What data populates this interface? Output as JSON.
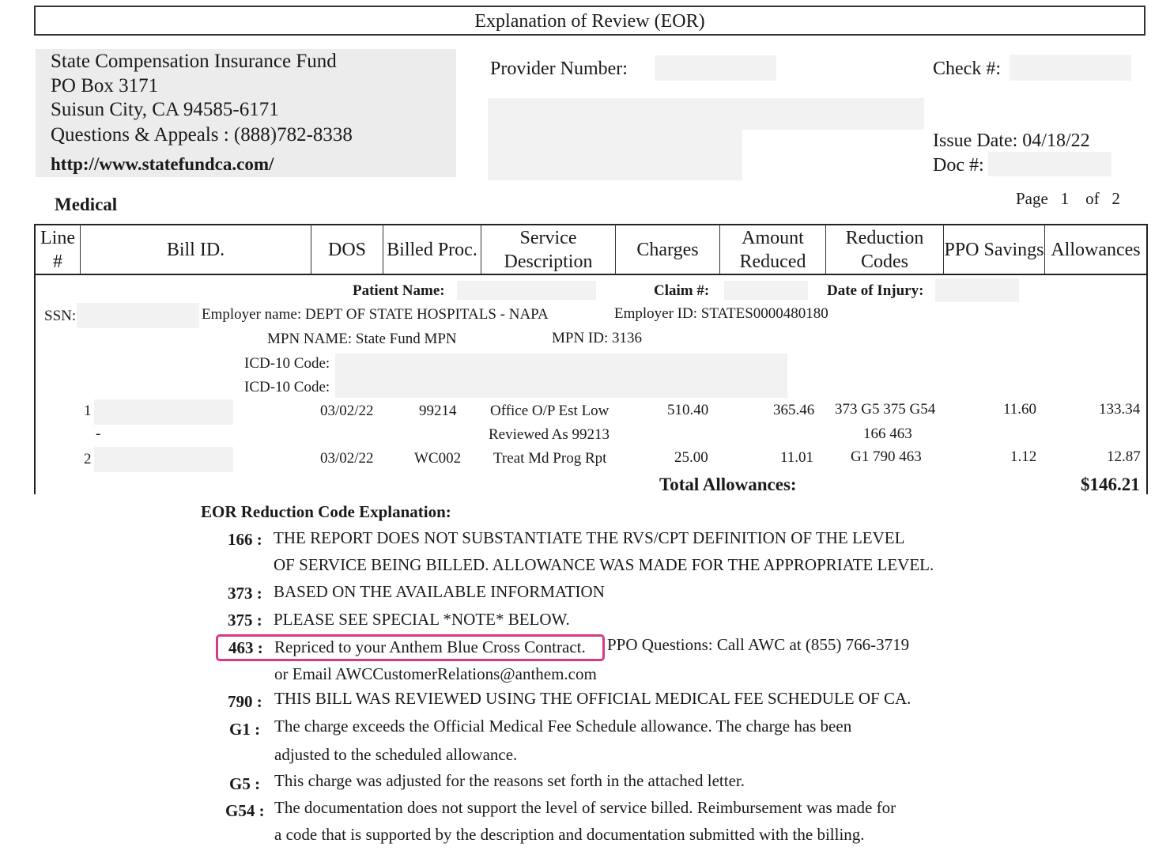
{
  "document": {
    "title": "Explanation of Review (EOR)",
    "insurer": {
      "name": "State Compensation Insurance Fund",
      "po_box": "PO Box 3171",
      "city": "Suisun City, CA 94585-6171",
      "phone": "Questions & Appeals : (888)782-8338",
      "website": "http://www.statefundca.com/"
    },
    "provider_number_label": "Provider Number:",
    "check_label": "Check #:",
    "issue_date": "Issue Date: 04/18/22",
    "doc_label": "Doc #:",
    "section": "Medical",
    "page_label": "Page",
    "page_num": "1",
    "page_of": "of",
    "page_total": "2"
  },
  "table": {
    "headers": [
      "Line #",
      "Bill ID.",
      "DOS",
      "Billed Proc.",
      "Service Description",
      "Charges",
      "Amount Reduced",
      "Reduction Codes",
      "PPO Savings",
      "Allowances"
    ],
    "patient_label": "Patient Name:",
    "claim_label": "Claim #:",
    "injury_label": "Date of Injury:",
    "ssn_label": "SSN:",
    "employer_name": "Employer name: DEPT OF STATE HOSPITALS - NAPA",
    "employer_id": "Employer ID: STATES0000480180",
    "mpn_name": "MPN NAME: State Fund MPN",
    "mpn_id": "MPN ID: 3136",
    "icd_label_1": "ICD-10 Code:",
    "icd_label_2": "ICD-10 Code:",
    "rows": [
      {
        "line": "1",
        "dos": "03/02/22",
        "proc": "99214",
        "desc": "Office O/P Est Low",
        "charges": "510.40",
        "reduced": "365.46",
        "codes": "373 G5 375 G54",
        "ppo": "11.60",
        "allow": "133.34"
      },
      {
        "line": "-",
        "desc": "Reviewed As 99213",
        "codes": "166 463"
      },
      {
        "line": "2",
        "dos": "03/02/22",
        "proc": "WC002",
        "desc": "Treat Md Prog Rpt",
        "charges": "25.00",
        "reduced": "11.01",
        "codes": "G1 790 463",
        "ppo": "1.12",
        "allow": "12.87"
      }
    ],
    "total_label": "Total Allowances:",
    "total_value": "$146.21"
  },
  "explanations": {
    "heading": "EOR Reduction Code Explanation:",
    "codes": [
      {
        "code": "166 :",
        "lines": [
          "THE REPORT DOES NOT SUBSTANTIATE THE RVS/CPT DEFINITION OF THE LEVEL",
          "OF SERVICE BEING BILLED. ALLOWANCE WAS MADE FOR THE APPROPRIATE LEVEL."
        ]
      },
      {
        "code": "373 :",
        "lines": [
          "BASED ON THE AVAILABLE INFORMATION"
        ]
      },
      {
        "code": "375 :",
        "lines": [
          "PLEASE SEE SPECIAL *NOTE* BELOW."
        ]
      },
      {
        "code": "463 :",
        "lines": [
          "Repriced to your Anthem Blue Cross Contract.",
          "PPO Questions: Call AWC at (855) 766-3719",
          "or Email AWCCustomerRelations@anthem.com"
        ]
      },
      {
        "code": "790 :",
        "lines": [
          "THIS BILL WAS REVIEWED USING THE OFFICIAL MEDICAL FEE SCHEDULE OF CA."
        ]
      },
      {
        "code": "G1 :",
        "lines": [
          "The charge exceeds the Official Medical Fee Schedule allowance. The charge has been",
          "adjusted to the scheduled allowance."
        ]
      },
      {
        "code": "G5 :",
        "lines": [
          "This charge was adjusted for the reasons set forth in the attached letter."
        ]
      },
      {
        "code": "G54 :",
        "lines": [
          "The documentation does not support the level of service billed. Reimbursement was made for",
          "a code that is supported by the description and documentation submitted with the billing."
        ]
      }
    ]
  },
  "colors": {
    "highlight": "#d63b86",
    "redaction": "#f2f2f2"
  }
}
